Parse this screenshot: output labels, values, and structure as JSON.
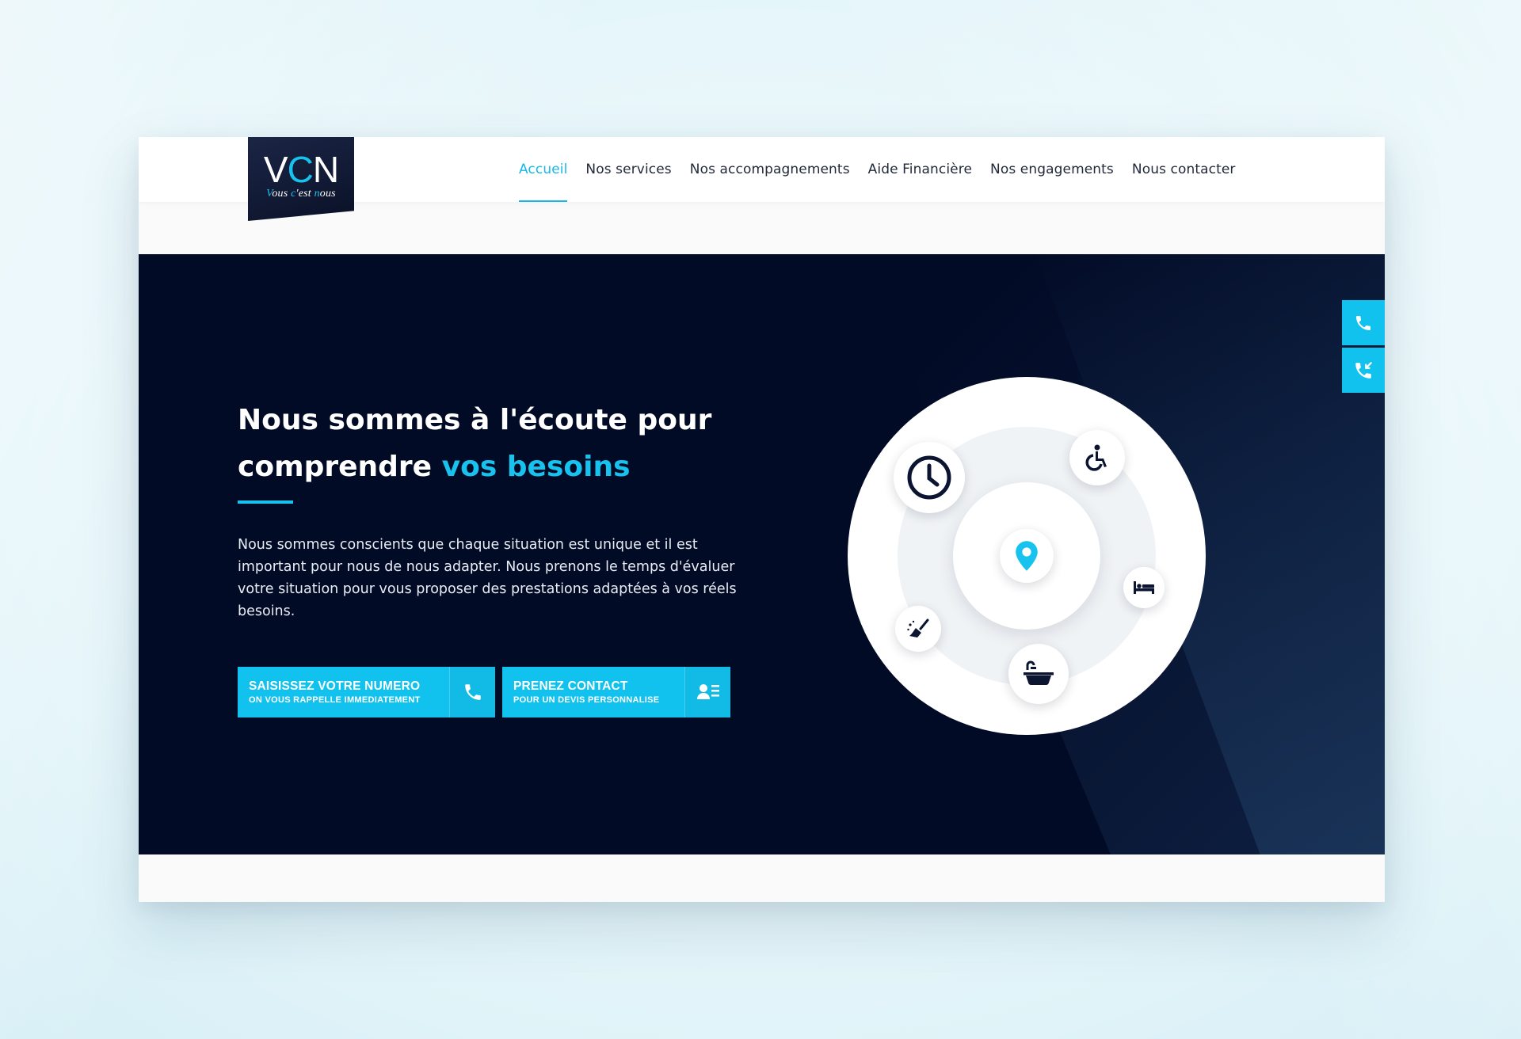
{
  "logo": {
    "main_v": "V",
    "main_c": "C",
    "main_n": "N",
    "tag_1": "ous ",
    "tag_v": "V",
    "tag_c": "c",
    "tag_2": "'est ",
    "tag_n": "n",
    "tag_3": "ous"
  },
  "nav": {
    "items": [
      {
        "label": "Accueil",
        "active": true
      },
      {
        "label": "Nos services"
      },
      {
        "label": "Nos accompagnements"
      },
      {
        "label": "Aide Financière"
      },
      {
        "label": "Nos engagements"
      },
      {
        "label": "Nous contacter"
      }
    ]
  },
  "hero": {
    "title_part1": "Nous sommes à l'écoute pour comprendre ",
    "title_accent": "vos besoins",
    "paragraph": "Nous sommes conscients que chaque situation est unique et il est important pour nous de nous adapter. Nous prenons le temps d'évaluer votre situation pour vous proposer des prestations adaptées à vos réels besoins.",
    "cta1": {
      "line1": "SAISISSEZ VOTRE NUMERO",
      "line2": "ON VOUS RAPPELLE IMMEDIATEMENT",
      "icon": "phone-icon"
    },
    "cta2": {
      "line1": "PRENEZ CONTACT",
      "line2": "POUR UN DEVIS PERSONNALISE",
      "icon": "contact-card-icon"
    }
  },
  "side_buttons": [
    {
      "icon": "phone-icon"
    },
    {
      "icon": "phone-callback-icon"
    }
  ],
  "diagram_icons": [
    "map-pin-icon",
    "clock-icon",
    "wheelchair-icon",
    "bed-icon",
    "bathtub-icon",
    "cleaning-broom-icon"
  ],
  "colors": {
    "accent": "#17c3ee",
    "hero_bg": "#020b26",
    "nav_text": "#222a3a"
  }
}
